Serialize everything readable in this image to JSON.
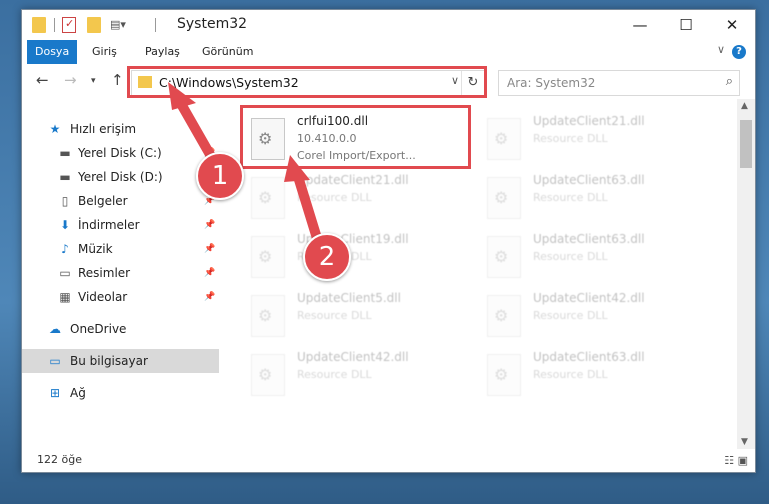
{
  "window": {
    "title": "System32",
    "controls": {
      "minimize": "—",
      "maximize": "☐",
      "close": "✕"
    }
  },
  "ribbon": {
    "tabs": [
      "Dosya",
      "Giriş",
      "Paylaş",
      "Görünüm"
    ],
    "active_tab": "Dosya",
    "help": "?"
  },
  "nav": {
    "back": "←",
    "forward": "→",
    "up": "↑",
    "address": "C:\\Windows\\System32",
    "search_placeholder": "Ara: System32"
  },
  "sidebar": {
    "items": [
      {
        "label": "Hızlı erişim",
        "icon": "star-icon",
        "pinned": false
      },
      {
        "label": "Yerel Disk (C:)",
        "icon": "drive-icon",
        "pinned": true
      },
      {
        "label": "Yerel Disk (D:)",
        "icon": "drive-icon",
        "pinned": true
      },
      {
        "label": "Belgeler",
        "icon": "documents-icon",
        "pinned": true
      },
      {
        "label": "İndirmeler",
        "icon": "download-icon",
        "pinned": true
      },
      {
        "label": "Müzik",
        "icon": "music-icon",
        "pinned": true
      },
      {
        "label": "Resimler",
        "icon": "pictures-icon",
        "pinned": true
      },
      {
        "label": "Videolar",
        "icon": "videos-icon",
        "pinned": true
      },
      {
        "label": "OneDrive",
        "icon": "cloud-icon",
        "pinned": false
      },
      {
        "label": "Bu bilgisayar",
        "icon": "computer-icon",
        "pinned": false,
        "selected": true
      },
      {
        "label": "Ağ",
        "icon": "network-icon",
        "pinned": false
      }
    ]
  },
  "files": {
    "left": [
      {
        "name": "crlfui100.dll",
        "version": "10.410.0.0",
        "desc": "Corel Import/Export...",
        "highlighted": true
      },
      {
        "name": "UpdateClient21.dll",
        "version": "",
        "desc": "Resource DLL"
      },
      {
        "name": "UpdateClient19.dll",
        "version": "",
        "desc": "Resource DLL"
      },
      {
        "name": "UpdateClient5.dll",
        "version": "",
        "desc": "Resource DLL"
      },
      {
        "name": "UpdateClient42.dll",
        "version": "",
        "desc": "Resource DLL"
      }
    ],
    "right": [
      {
        "name": "UpdateClient21.dll",
        "desc": "Resource DLL"
      },
      {
        "name": "UpdateClient63.dll",
        "desc": "Resource DLL"
      },
      {
        "name": "UpdateClient63.dll",
        "desc": "Resource DLL"
      },
      {
        "name": "UpdateClient42.dll",
        "desc": "Resource DLL"
      },
      {
        "name": "UpdateClient63.dll",
        "desc": "Resource DLL"
      }
    ]
  },
  "status": {
    "count": "122 öğe"
  },
  "annotations": {
    "step1": "1",
    "step2": "2",
    "color": "#e14a4f"
  }
}
